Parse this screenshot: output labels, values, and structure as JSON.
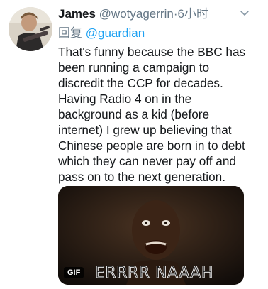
{
  "tweet": {
    "author_name": "James",
    "handle": "@wotyagerrin",
    "separator": "·",
    "timestamp": "6小时",
    "reply_label": "回复",
    "reply_mention": "@guardian",
    "text": "That's funny because the BBC has\nbeen running a campaign to\ndiscredit the CCP for decades.\nHaving Radio 4 on in the\nbackground as a kid (before\ninternet) I grew up believing that\nChinese people are born in to debt\nwhich they can never pay off and\npass on to the next generation.",
    "media": {
      "badge": "GIF",
      "caption": "ERRRR NAAAH"
    }
  },
  "icons": {
    "menu": "chevron-down-icon"
  },
  "colors": {
    "link": "#1da1f2",
    "secondary_text": "#657786",
    "primary_text": "#14171a"
  }
}
